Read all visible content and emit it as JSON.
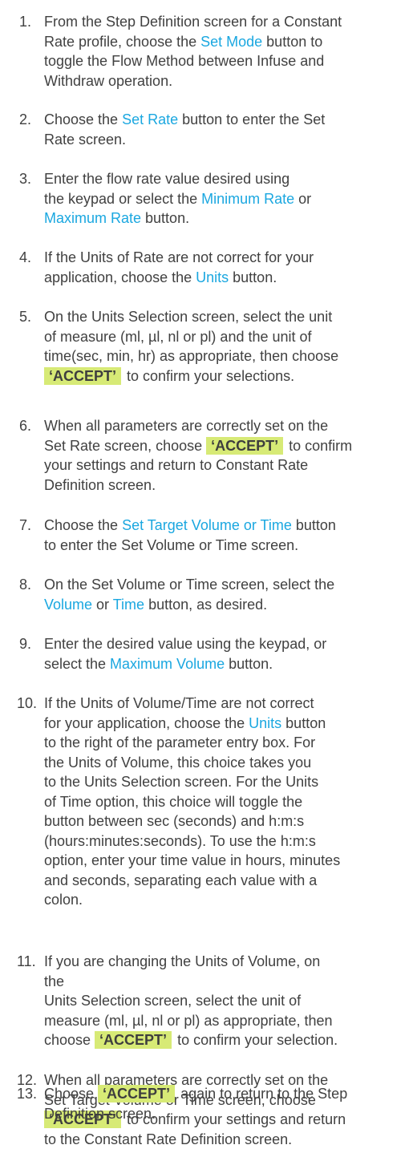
{
  "steps": [
    {
      "n": "1.",
      "lines": [
        [
          {
            "t": "From the Step Definition screen for a Constant"
          }
        ],
        [
          {
            "t": "Rate profile, choose the "
          },
          {
            "t": "Set Mode",
            "s": "hl"
          },
          {
            "t": " button to"
          }
        ],
        [
          {
            "t": "toggle the Flow Method between Infuse and"
          }
        ],
        [
          {
            "t": "Withdraw operation."
          }
        ]
      ]
    },
    {
      "n": "2.",
      "lines": [
        [
          {
            "t": "Choose the "
          },
          {
            "t": "Set Rate",
            "s": "hl"
          },
          {
            "t": " button to enter the Set"
          }
        ],
        [
          {
            "t": "Rate screen."
          }
        ]
      ]
    },
    {
      "n": "3.",
      "lines": [
        [
          {
            "t": "Enter the flow rate value desired using"
          }
        ],
        [
          {
            "t": "the keypad or select the "
          },
          {
            "t": "Minimum Rate",
            "s": "hl"
          },
          {
            "t": " or"
          }
        ],
        [
          {
            "t": "Maximum Rate",
            "s": "hl"
          },
          {
            "t": " button."
          }
        ]
      ]
    },
    {
      "n": "4.",
      "lines": [
        [
          {
            "t": "If the Units of Rate are not correct for your"
          }
        ],
        [
          {
            "t": "application, choose the "
          },
          {
            "t": "Units",
            "s": "hl"
          },
          {
            "t": " button."
          }
        ]
      ]
    },
    {
      "n": "5.",
      "lines": [
        [
          {
            "t": "On the Units Selection screen, select the unit"
          }
        ],
        [
          {
            "t": "of   measure (ml, µl, nl or pl) and the unit of"
          }
        ],
        [
          {
            "t": "time(sec, min, hr) as appropriate, then choose"
          }
        ],
        [
          {
            "t": "‘ACCEPT’",
            "s": "acc"
          },
          {
            "t": " to confirm your selections."
          }
        ]
      ]
    },
    {
      "n": "6.",
      "lines": [
        [
          {
            "t": "When all parameters are correctly set on the"
          }
        ],
        [
          {
            "t": "Set Rate screen, choose "
          },
          {
            "t": "‘ACCEPT’",
            "s": "acc"
          },
          {
            "t": " to confirm"
          }
        ],
        [
          {
            "t": "your settings and return to Constant Rate"
          }
        ],
        [
          {
            "t": "Definition screen."
          }
        ]
      ]
    },
    {
      "n": "7.",
      "lines": [
        [
          {
            "t": "Choose the "
          },
          {
            "t": "Set Target Volume or Time",
            "s": "hl"
          },
          {
            "t": " button"
          }
        ],
        [
          {
            "t": "to enter the Set Volume or Time screen."
          }
        ]
      ]
    },
    {
      "n": "8.",
      "lines": [
        [
          {
            "t": "On the Set Volume or Time screen, select the"
          }
        ],
        [
          {
            "t": "Volume",
            "s": "hl"
          },
          {
            "t": " or "
          },
          {
            "t": "Time",
            "s": "hl"
          },
          {
            "t": " button, as desired."
          }
        ]
      ]
    },
    {
      "n": "9.",
      "lines": [
        [
          {
            "t": "Enter the desired value using the keypad, or"
          }
        ],
        [
          {
            "t": "select the "
          },
          {
            "t": "Maximum Volume",
            "s": "hl"
          },
          {
            "t": " button."
          }
        ]
      ]
    },
    {
      "n": "10.",
      "lines": [
        [
          {
            "t": "If the Units of Volume/Time are not correct"
          }
        ],
        [
          {
            "t": "for your application, choose the "
          },
          {
            "t": "Units",
            "s": "hl"
          },
          {
            "t": " button"
          }
        ],
        [
          {
            "t": "to the right of the parameter entry box. For"
          }
        ],
        [
          {
            "t": "the Units of Volume, this choice takes you"
          }
        ],
        [
          {
            "t": "to the Units Selection screen. For the Units"
          }
        ],
        [
          {
            "t": "of Time option, this choice will toggle the"
          }
        ],
        [
          {
            "t": "button between sec (seconds) and h:m:s"
          }
        ],
        [
          {
            "t": "(hours:minutes:seconds). To use the h:m:s"
          }
        ],
        [
          {
            "t": "option, enter your time value in hours, minutes"
          }
        ],
        [
          {
            "t": "and seconds, separating each value with a"
          }
        ],
        [
          {
            "t": "colon."
          }
        ]
      ]
    },
    {
      "n": "11.",
      "lines": [
        [
          {
            "t": "If you are changing the Units of Volume, on"
          }
        ],
        [
          {
            "t": "the"
          }
        ],
        [
          {
            "t": "Units Selection screen, select the unit of"
          }
        ],
        [
          {
            "t": "measure (ml, µl, nl or pl) as appropriate, then"
          }
        ],
        [
          {
            "t": "choose "
          },
          {
            "t": "‘ACCEPT’",
            "s": "acc"
          },
          {
            "t": " to confirm your selection."
          }
        ]
      ]
    },
    {
      "n": "12.",
      "lines": [
        [
          {
            "t": "When all parameters are correctly set on the"
          }
        ],
        [
          {
            "t": "Set Target Volume or Time screen, choose"
          }
        ],
        [
          {
            "t": "‘ACCEPT’",
            "s": "acc"
          },
          {
            "t": " to confirm your settings and return"
          }
        ],
        [
          {
            "t": "to the Constant Rate Definition screen."
          }
        ]
      ]
    },
    {
      "n": "13.",
      "lines": [
        [
          {
            "t": "Choose "
          },
          {
            "t": "‘ACCEPT’",
            "s": "acc"
          },
          {
            "t": " again to return to the Step"
          }
        ],
        [
          {
            "t": "Definition screen."
          }
        ]
      ]
    }
  ],
  "colors": {
    "text": "#414141",
    "link": "#1aa7e0",
    "accept_bg": "#d7ea76"
  }
}
